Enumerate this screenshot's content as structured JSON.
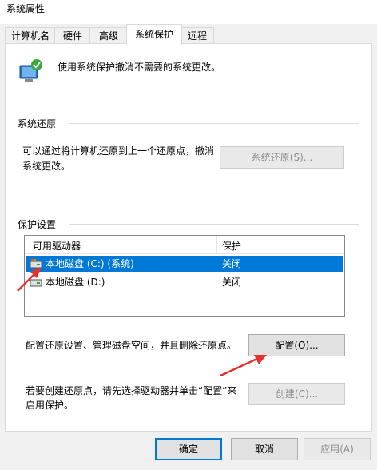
{
  "window": {
    "title": "系统属性"
  },
  "tabs": [
    {
      "label": "计算机名"
    },
    {
      "label": "硬件"
    },
    {
      "label": "高级"
    },
    {
      "label": "系统保护"
    },
    {
      "label": "远程"
    }
  ],
  "header": {
    "description": "使用系统保护撤消不需要的系统更改。"
  },
  "restore": {
    "group_title": "系统还原",
    "text": "可以通过将计算机还原到上一个还原点，撤消系统更改。",
    "button": "系统还原(S)..."
  },
  "protection": {
    "group_title": "保护设置",
    "columns": [
      "可用驱动器",
      "保护"
    ],
    "rows": [
      {
        "drive": "本地磁盘 (C:) (系统)",
        "status": "关闭"
      },
      {
        "drive": "本地磁盘 (D:)",
        "status": "关闭"
      }
    ],
    "configure_text": "配置还原设置、管理磁盘空间，并且删除还原点。",
    "configure_button": "配置(O)...",
    "create_text": "若要创建还原点，请先选择驱动器并单击“配置”来启用保护。",
    "create_button": "创建(C)..."
  },
  "footer": {
    "ok": "确定",
    "cancel": "取消",
    "apply": "应用(A)"
  },
  "colors": {
    "accent": "#0078d7",
    "arrow": "#e5322d"
  }
}
